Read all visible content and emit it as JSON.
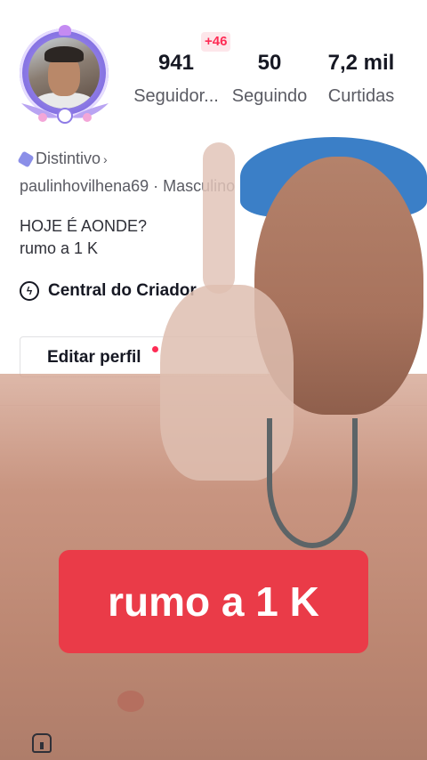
{
  "profile": {
    "stats": {
      "followers": {
        "value": "941",
        "label": "Seguidor...",
        "new_badge": "+46"
      },
      "following": {
        "value": "50",
        "label": "Seguindo"
      },
      "likes": {
        "value": "7,2 mil",
        "label": "Curtidas"
      }
    },
    "badge_label": "Distintivo",
    "username_line": "paulinhovilhena69 · Masculino",
    "bio": [
      "HOJE É AONDE?",
      "rumo a 1 K"
    ],
    "creator_center_label": "Central do Criador",
    "edit_profile_label": "Editar perfil"
  },
  "overlay": {
    "caption": "rumo a 1 K"
  },
  "colors": {
    "accent": "#fe2c55",
    "caption_bg": "#ea3b48",
    "cap_blue": "#3b7fc7",
    "badge_purple": "#8b8fe8"
  },
  "icons": [
    "avatar-frame",
    "hexagon-badge-icon",
    "chevron-right-icon",
    "lightning-icon",
    "instagram-icon",
    "home-icon"
  ]
}
